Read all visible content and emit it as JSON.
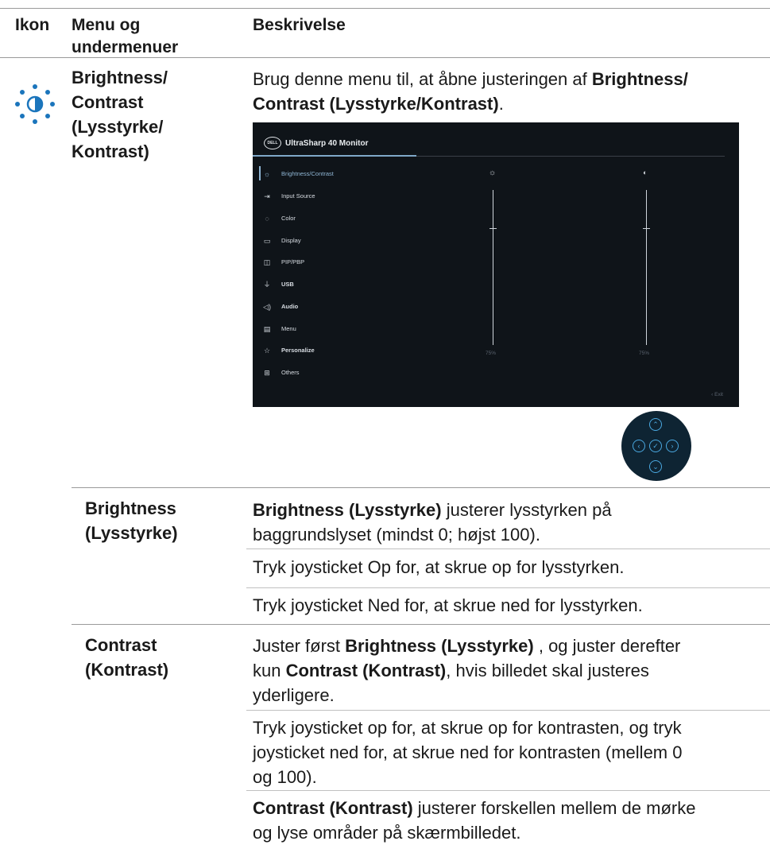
{
  "table": {
    "headers": {
      "icon": "Ikon",
      "menu": "Menu og undermenuer",
      "desc": "Beskrivelse"
    },
    "main_row": {
      "icon": "brightness-contrast-icon",
      "menu_lines": [
        "Brightness/",
        "Contrast",
        "(Lysstyrke/",
        "Kontrast)"
      ],
      "desc_prefix": "Brug denne menu til, at åbne justeringen af ",
      "desc_bold_1": "Brightness/",
      "desc_bold_2": "Contrast (Lysstyrke/Kontrast)",
      "desc_suffix": "."
    },
    "sub_rows": [
      {
        "menu_lines": [
          "Brightness",
          "(Lysstyrke)"
        ],
        "p1_bold": "Brightness (Lysstyrke)",
        "p1_line1": " justerer lysstyrken på",
        "p1_line2": "baggrundslyset (mindst 0; højst 100).",
        "p2": "Tryk joysticket Op for, at skrue op for lysstyrken.",
        "p3": "Tryk joysticket Ned for, at skrue ned for lysstyrken."
      },
      {
        "menu_lines": [
          "Contrast",
          "(Kontrast)"
        ],
        "p1_a": "Juster først ",
        "p1_bold_a": "Brightness (Lysstyrke)",
        "p1_b": " , og juster derefter",
        "p1_c": "kun ",
        "p1_bold_b": "Contrast (Kontrast)",
        "p1_d": ", hvis billedet skal justeres",
        "p1_e": "yderligere.",
        "p2_lines": [
          "Tryk joysticket op for, at skrue op for kontrasten, og tryk",
          "joysticket ned for, at skrue ned for kontrasten (mellem 0",
          "og 100)."
        ],
        "p3_bold": "Contrast (Kontrast)",
        "p3_line1": " justerer forskellen mellem de mørke",
        "p3_line2": "og lyse områder på skærmbilledet."
      }
    ]
  },
  "osd": {
    "logo": "DELL",
    "title": "UltraSharp 40 Monitor",
    "menu": [
      {
        "icon": "sun-icon",
        "label": "Brightness/Contrast",
        "active": true
      },
      {
        "icon": "input-source-icon",
        "label": "Input Source"
      },
      {
        "icon": "color-palette-icon",
        "label": "Color"
      },
      {
        "icon": "display-icon",
        "label": "Display"
      },
      {
        "icon": "pip-pbp-icon",
        "label": "PIP/PBP"
      },
      {
        "icon": "usb-icon",
        "label": "USB"
      },
      {
        "icon": "audio-icon",
        "label": "Audio"
      },
      {
        "icon": "menu-icon",
        "label": "Menu"
      },
      {
        "icon": "star-icon",
        "label": "Personalize"
      },
      {
        "icon": "others-icon",
        "label": "Others"
      }
    ],
    "brightness_value": "75%",
    "contrast_value": "75%",
    "exit_label": "Exit",
    "accent_color": "#8fb6d4"
  },
  "joystick": {
    "buttons": [
      "up",
      "left",
      "ok",
      "right",
      "down"
    ],
    "color": "#4aa8e0"
  }
}
